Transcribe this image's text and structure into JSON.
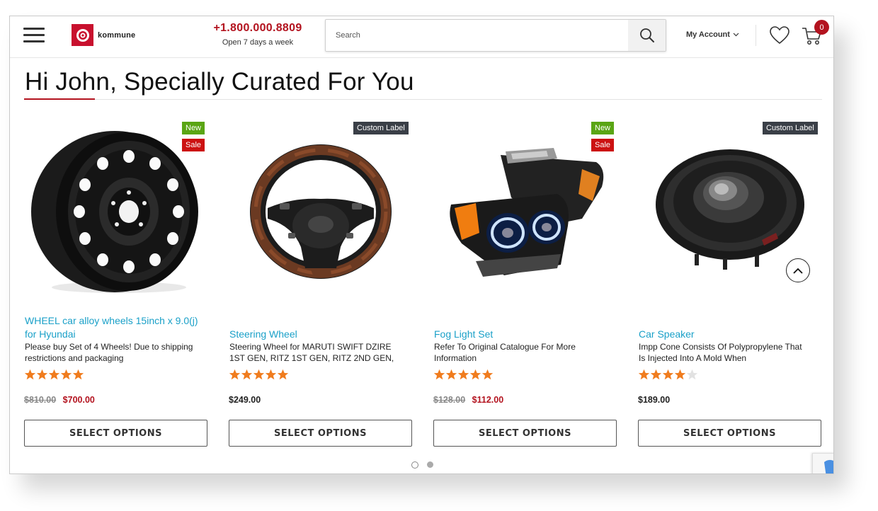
{
  "header": {
    "logo_text": "kommune",
    "phone": "+1.800.000.8809",
    "hours": "Open 7 days a week",
    "search_placeholder": "Search",
    "account_label": "My Account",
    "cart_count": "0"
  },
  "page": {
    "title": "Hi John, Specially Curated For You"
  },
  "products": [
    {
      "title": "WHEEL car alloy wheels 15inch x 9.0(j) for Hyundai",
      "description": "Please buy Set of 4 Wheels! Due to shipping restrictions and packaging",
      "badges": [
        "New",
        "Sale"
      ],
      "rating": 5,
      "old_price": "$810.00",
      "price": "$700.00",
      "button": "SELECT OPTIONS",
      "image": "wheel-icon"
    },
    {
      "title": "Steering Wheel",
      "description": "Steering Wheel for MARUTI SWIFT DZIRE 1ST GEN, RITZ 1ST GEN, RITZ 2ND GEN,",
      "badges": [
        "Custom Label"
      ],
      "rating": 5,
      "old_price": "",
      "price": "$249.00",
      "button": "SELECT OPTIONS",
      "image": "steering-wheel-icon"
    },
    {
      "title": "Fog Light Set",
      "description": "Refer To Original Catalogue For More Information",
      "badges": [
        "New",
        "Sale"
      ],
      "rating": 5,
      "old_price": "$128.00",
      "price": "$112.00",
      "button": "SELECT OPTIONS",
      "image": "headlight-icon"
    },
    {
      "title": "Car Speaker",
      "description": "Impp Cone Consists Of Polypropylene That Is Injected Into A Mold When",
      "badges": [
        "Custom Label"
      ],
      "rating": 4,
      "old_price": "",
      "price": "$189.00",
      "button": "SELECT OPTIONS",
      "image": "speaker-icon"
    }
  ],
  "colors": {
    "brand": "#b3131f",
    "link": "#1aa0c8",
    "badge_new": "#5aa514",
    "badge_sale": "#cc1111",
    "badge_custom": "#3a3f47",
    "star": "#f07c1e"
  }
}
